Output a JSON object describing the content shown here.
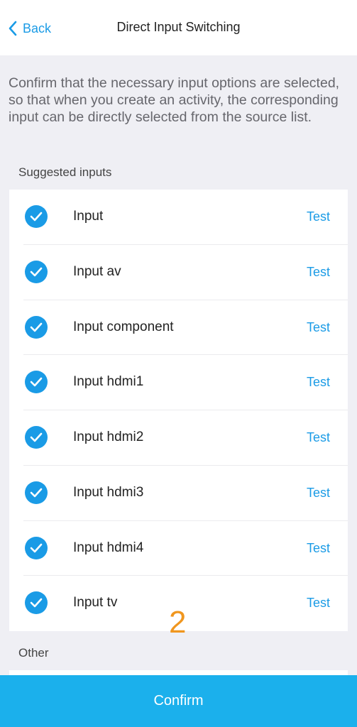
{
  "nav": {
    "back_label": "Back",
    "title": "Direct Input Switching"
  },
  "description": "Confirm that the necessary input options are selected, so that when you create an activity, the corresponding input can be directly selected from the source list.",
  "suggested": {
    "label": "Suggested inputs",
    "items": [
      {
        "label": "Input",
        "checked": true,
        "test_label": "Test"
      },
      {
        "label": "Input av",
        "checked": true,
        "test_label": "Test"
      },
      {
        "label": "Input component",
        "checked": true,
        "test_label": "Test"
      },
      {
        "label": "Input hdmi1",
        "checked": true,
        "test_label": "Test"
      },
      {
        "label": "Input hdmi2",
        "checked": true,
        "test_label": "Test"
      },
      {
        "label": "Input hdmi3",
        "checked": true,
        "test_label": "Test"
      },
      {
        "label": "Input hdmi4",
        "checked": true,
        "test_label": "Test"
      },
      {
        "label": "Input tv",
        "checked": true,
        "test_label": "Test"
      }
    ]
  },
  "overlay_number": "2",
  "other": {
    "label": "Other"
  },
  "confirm_label": "Confirm",
  "colors": {
    "accent": "#1a9be6",
    "confirm_bg": "#1bb0ec",
    "overlay_number": "#f0961e",
    "background": "#efeff4"
  },
  "icons": {
    "back": "chevron-left-icon",
    "check": "check-circle-icon"
  }
}
